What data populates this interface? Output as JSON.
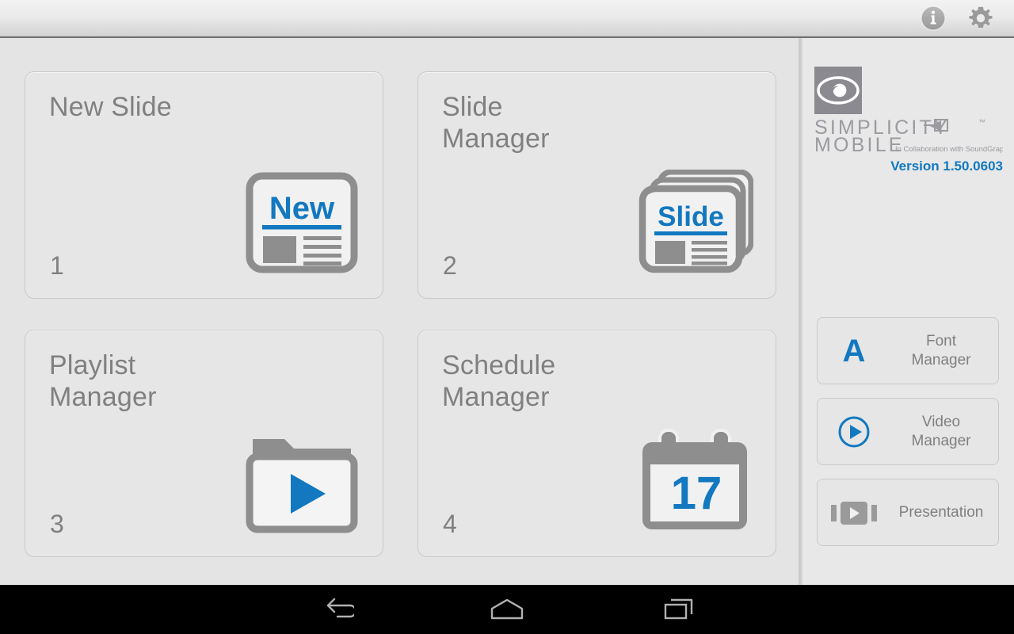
{
  "app": {
    "name": "Simplicity Mobile",
    "accent_color": "#1278c0",
    "text_color": "#808080",
    "tile_bg": "#e6e6e6",
    "pane_bg": "#e4e4e4"
  },
  "topbar": {
    "actions": [
      {
        "name": "info-icon",
        "label": "Info",
        "glyph": "i"
      },
      {
        "name": "gear-icon",
        "label": "Settings",
        "glyph": "gear"
      }
    ]
  },
  "tiles": [
    {
      "title": "New Slide",
      "index": "1",
      "icon": "new-slide-icon",
      "icon_text": "New"
    },
    {
      "title": "Slide\nManager",
      "index": "2",
      "icon": "slide-manager-icon",
      "icon_text": "Slide"
    },
    {
      "title": "Playlist\nManager",
      "index": "3",
      "icon": "playlist-folder-play-icon",
      "icon_text": ""
    },
    {
      "title": "Schedule\nManager",
      "index": "4",
      "icon": "calendar-icon",
      "icon_text": "17"
    }
  ],
  "branding": {
    "logo": "eye-logo-icon",
    "name_line1": "SIMPLICITY",
    "name_line2": "MOBILE",
    "trademark": "™",
    "collaboration": "In Collaboration with SoundGraph",
    "version": "Version 1.50.0603"
  },
  "side_buttons": [
    {
      "label": "Font\nManager",
      "icon": "font-a-icon",
      "icon_text": "A"
    },
    {
      "label": "Video\nManager",
      "icon": "video-play-circle-icon",
      "icon_text": ""
    },
    {
      "label": "Presentation",
      "icon": "presentation-film-icon",
      "icon_text": ""
    }
  ],
  "navbar": {
    "buttons": [
      {
        "name": "back-icon",
        "label": "Back"
      },
      {
        "name": "home-icon",
        "label": "Home"
      },
      {
        "name": "recents-icon",
        "label": "Recent apps"
      }
    ]
  }
}
